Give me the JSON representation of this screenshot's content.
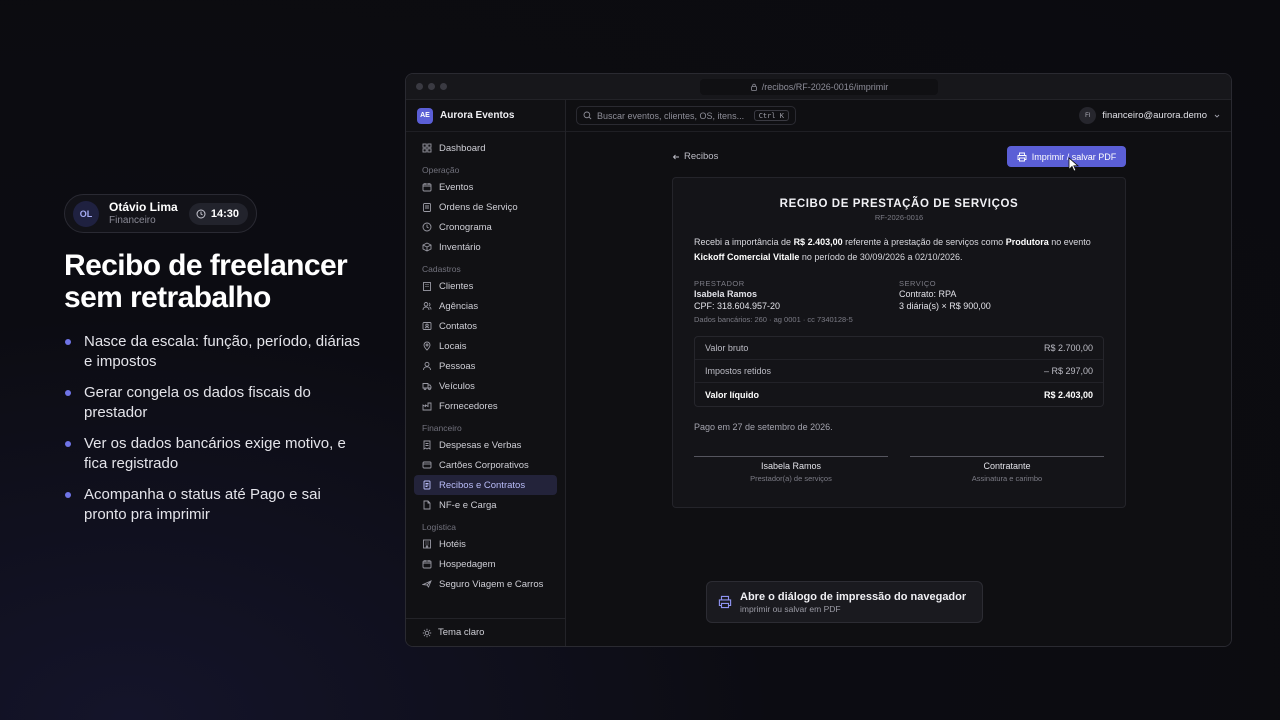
{
  "promo": {
    "user": {
      "initials": "OL",
      "name": "Otávio Lima",
      "role": "Financeiro",
      "time": "14:30"
    },
    "title": "Recibo de freelancer sem retrabalho",
    "bullets": [
      "Nasce da escala: função, período, diárias e impostos",
      "Gerar congela os dados fiscais do prestador",
      "Ver os dados bancários exige motivo, e fica registrado",
      "Acompanha o status até Pago e sai pronto pra imprimir"
    ]
  },
  "browser": {
    "url": "/recibos/RF-2026-0016/imprimir"
  },
  "sidebar": {
    "brand_initials": "AE",
    "brand_name": "Aurora Eventos",
    "dashboard": "Dashboard",
    "sections": {
      "operacao": "Operação",
      "cadastros": "Cadastros",
      "financeiro": "Financeiro",
      "logistica": "Logística"
    },
    "operacao": [
      "Eventos",
      "Ordens de Serviço",
      "Cronograma",
      "Inventário"
    ],
    "cadastros": [
      "Clientes",
      "Agências",
      "Contatos",
      "Locais",
      "Pessoas",
      "Veículos",
      "Fornecedores"
    ],
    "financeiro": [
      "Despesas e Verbas",
      "Cartões Corporativos",
      "Recibos e Contratos",
      "NF-e e Carga"
    ],
    "logistica": [
      "Hotéis",
      "Hospedagem",
      "Seguro Viagem e Carros"
    ],
    "footer": "Tema claro"
  },
  "topbar": {
    "search_placeholder": "Buscar eventos, clientes, OS, itens...",
    "shortcut": "Ctrl K",
    "account_initials": "FI",
    "account_email": "financeiro@aurora.demo"
  },
  "page": {
    "back_label": "Recibos",
    "print_label": "Imprimir / salvar PDF"
  },
  "receipt": {
    "title": "RECIBO DE PRESTAÇÃO DE SERVIÇOS",
    "id": "RF-2026-0016",
    "p1": "Recebi a importância de ",
    "amount": "R$ 2.403,00",
    "p2": " referente à prestação de serviços como ",
    "role": "Produtora",
    "p3": " no evento ",
    "event": "Kickoff Comercial Vitalle",
    "p4": " no período de 30/09/2026 a 02/10/2026.",
    "prestador_label": "PRESTADOR",
    "prestador_name": "Isabela Ramos",
    "cpf": "CPF: 318.604.957-20",
    "bank": "Dados bancários: 260 · ag 0001 · cc 7340128-5",
    "servico_label": "SERVIÇO",
    "contrato": "Contrato: RPA",
    "diarias": "3 diária(s) × R$ 900,00",
    "rows": [
      {
        "label": "Valor bruto",
        "value": "R$ 2.700,00"
      },
      {
        "label": "Impostos retidos",
        "value": "– R$ 297,00"
      },
      {
        "label": "Valor líquido",
        "value": "R$ 2.403,00"
      }
    ],
    "paid": "Pago em 27 de setembro de 2026.",
    "sig1_name": "Isabela Ramos",
    "sig1_role": "Prestador(a) de serviços",
    "sig2_name": "Contratante",
    "sig2_role": "Assinatura e carimbo"
  },
  "toast": {
    "title": "Abre o diálogo de impressão do navegador",
    "subtitle": "imprimir ou salvar em PDF"
  },
  "colors": {
    "accent": "#5b5fd6",
    "bullet": "#6f74e6",
    "background": "#0b0b0f"
  }
}
